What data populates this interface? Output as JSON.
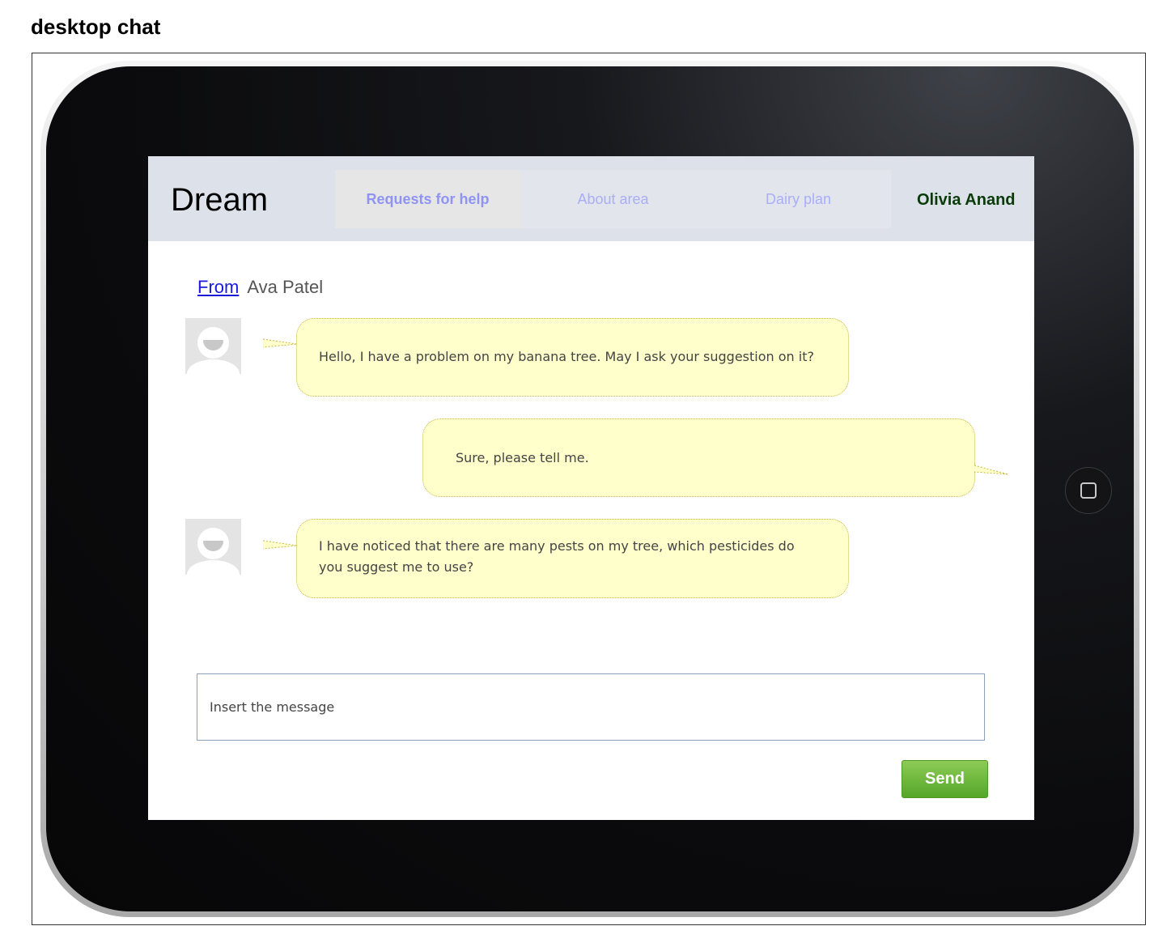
{
  "page": {
    "title": "desktop chat"
  },
  "app": {
    "brand": "Dream",
    "tabs": [
      {
        "label": "Requests for help",
        "active": true
      },
      {
        "label": "About area",
        "active": false
      },
      {
        "label": "Dairy plan",
        "active": false
      }
    ],
    "user_name": "Olivia Anand"
  },
  "chat": {
    "from_link": "From",
    "from_name": "Ava Patel",
    "messages": [
      {
        "sender": "Ava Patel",
        "text": "Hello, I have a problem on my banana tree. May I ask your suggestion on it?"
      },
      {
        "sender": "Olivia Anand",
        "text": "Sure, please tell me."
      },
      {
        "sender": "Ava Patel",
        "text": "I have noticed that there are many pests on my tree, which  pesticides do you suggest me to use?"
      }
    ]
  },
  "composer": {
    "placeholder": "Insert the message",
    "send_label": "Send"
  },
  "colors": {
    "bubble_fill": "#ffffcc",
    "nav_background": "#dde1e9",
    "send_button": "#6cb83a",
    "tab_text": "#a9aef7",
    "user_name": "#0a3a0a"
  },
  "icons": {
    "avatar": "user-avatar-icon",
    "home_button": "home-button-icon"
  }
}
